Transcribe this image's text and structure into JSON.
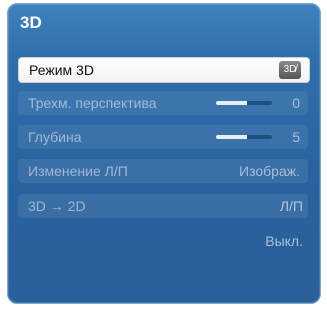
{
  "menu": {
    "title": "3D",
    "items": [
      {
        "label": "Режим 3D",
        "icon": "3d-icon",
        "state": "selected"
      },
      {
        "label": "Трехм. перспектива",
        "value": "0",
        "level": 0.55,
        "state": "disabled"
      },
      {
        "label": "Глубина",
        "value": "5",
        "level": 0.55,
        "state": "disabled"
      },
      {
        "label": "Изменение Л/П",
        "value": "Изображ.",
        "state": "disabled"
      },
      {
        "label": "3D → 2D",
        "state": "disabled"
      }
    ],
    "extra_options": [
      "Л/П",
      "Выкл."
    ]
  },
  "colors": {
    "panel": "#2f6fab",
    "selected_row": "#ffffff"
  }
}
